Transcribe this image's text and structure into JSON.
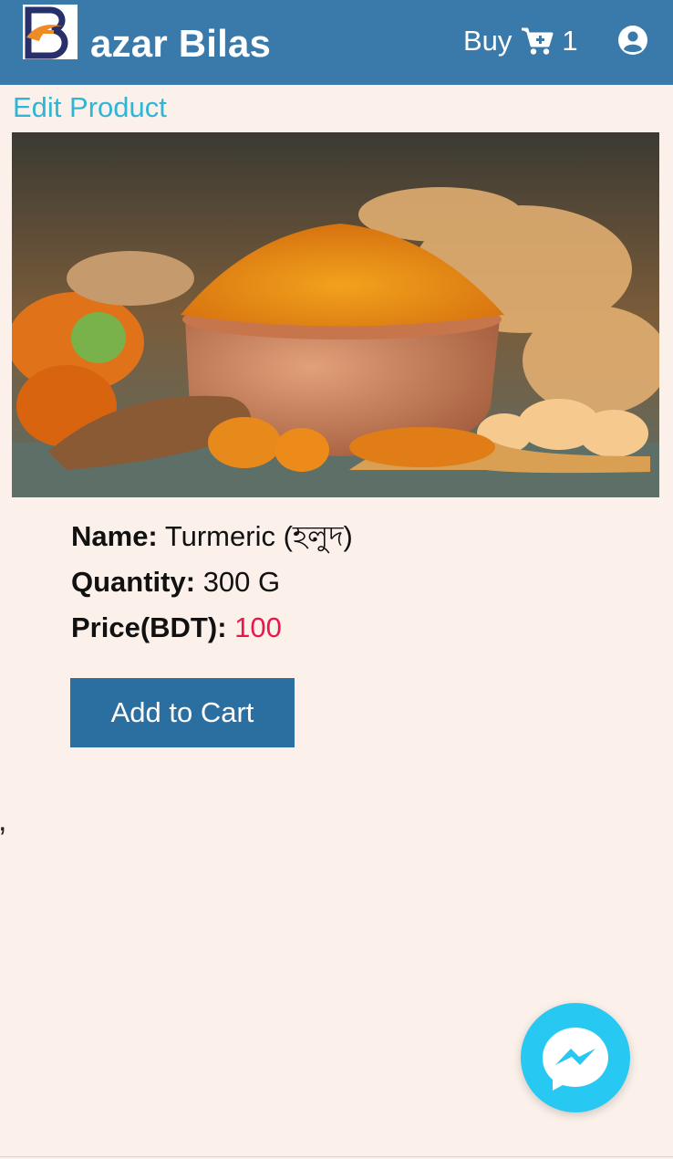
{
  "header": {
    "brand_text": "azar Bilas",
    "buy_label": "Buy",
    "cart_count": "1",
    "colors": {
      "navbar": "#3a7aab",
      "text": "#ffffff"
    },
    "icons": [
      "cart-plus-icon",
      "user-circle-icon"
    ]
  },
  "page": {
    "edit_link": "Edit Product",
    "background": "#fbf1ea"
  },
  "product": {
    "name_label": "Name:",
    "name_value": "Turmeric (হলুদ)",
    "quantity_label": "Quantity:",
    "quantity_value": "300 G",
    "price_label": "Price(BDT):",
    "price_value": "100",
    "price_color": "#e8184c"
  },
  "actions": {
    "add_to_cart": "Add to Cart",
    "button_color": "#2b6fa1"
  },
  "misc": {
    "stray_text": ","
  },
  "chat": {
    "icon": "messenger-icon",
    "color": "#27c8f2"
  }
}
